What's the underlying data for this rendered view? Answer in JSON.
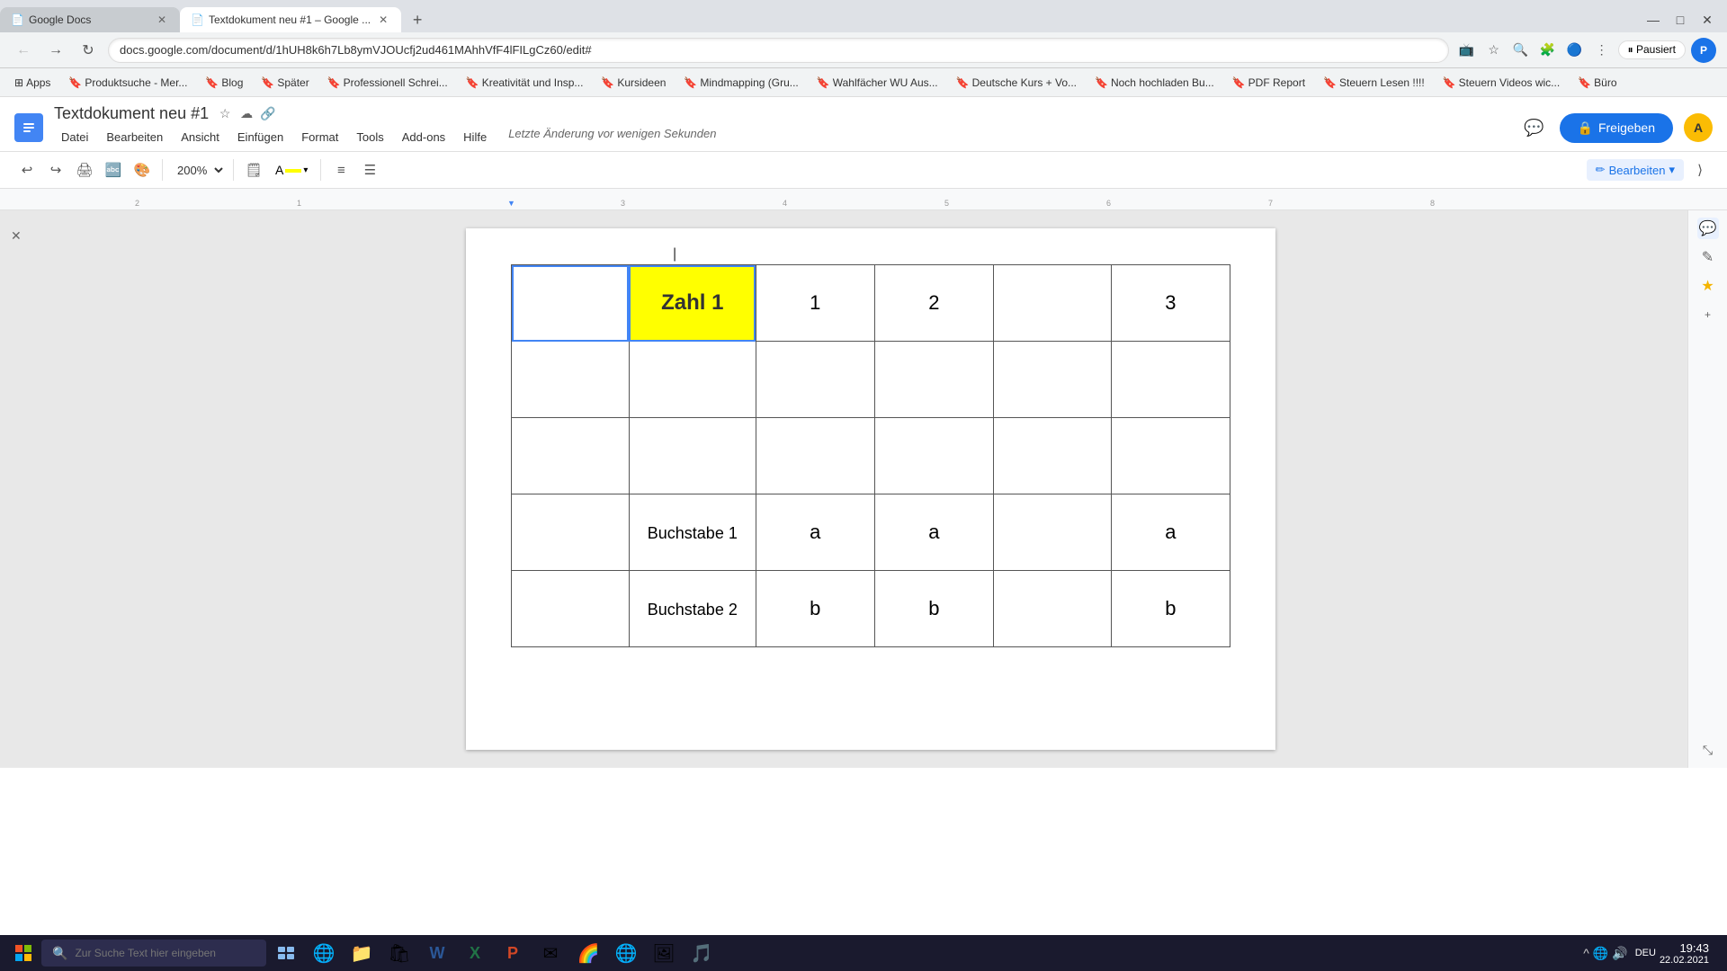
{
  "browser": {
    "tabs": [
      {
        "id": "tab1",
        "title": "Google Docs",
        "favicon": "📄",
        "active": false
      },
      {
        "id": "tab2",
        "title": "Textdokument neu #1 – Google ...",
        "favicon": "📄",
        "active": true
      }
    ],
    "address": "docs.google.com/document/d/1hUH8k6h7Lb8ymVJOUcfj2ud461MAhhVfF4lFILgCz60/edit#",
    "window_controls": [
      "—",
      "□",
      "✕"
    ]
  },
  "bookmarks": [
    {
      "label": "Apps",
      "icon": "⊞"
    },
    {
      "label": "Produktsuche - Mer...",
      "icon": "🔖"
    },
    {
      "label": "Blog",
      "icon": "🔖"
    },
    {
      "label": "Später",
      "icon": "🔖"
    },
    {
      "label": "Professionell Schrei...",
      "icon": "🔖"
    },
    {
      "label": "Kreativität und Insp...",
      "icon": "🔖"
    },
    {
      "label": "Kursideen",
      "icon": "🔖"
    },
    {
      "label": "Mindmapping (Gru...",
      "icon": "🔖"
    },
    {
      "label": "Wahlfächer WU Aus...",
      "icon": "🔖"
    },
    {
      "label": "Deutsche Kurs + Vo...",
      "icon": "🔖"
    },
    {
      "label": "Noch hochladen Bu...",
      "icon": "🔖"
    },
    {
      "label": "PDF Report",
      "icon": "🔖"
    },
    {
      "label": "Steuern Lesen !!!!",
      "icon": "🔖"
    },
    {
      "label": "Steuern Videos wic...",
      "icon": "🔖"
    },
    {
      "label": "Büro",
      "icon": "🔖"
    }
  ],
  "docs": {
    "title": "Textdokument neu #1",
    "autosave": "Letzte Änderung vor wenigen Sekunden",
    "menu": [
      "Datei",
      "Bearbeiten",
      "Ansicht",
      "Einfügen",
      "Format",
      "Tools",
      "Add-ons",
      "Hilfe"
    ],
    "toolbar": {
      "zoom": "200%",
      "edit_mode": "Bearbeiten",
      "share_label": "Freigeben"
    },
    "table": {
      "rows": [
        [
          "",
          "Zahl 1",
          "1",
          "2",
          "",
          "3"
        ],
        [
          "",
          "",
          "",
          "",
          "",
          ""
        ],
        [
          "",
          "",
          "",
          "",
          "",
          ""
        ],
        [
          "",
          "Buchstabe 1",
          "a",
          "a",
          "",
          "a"
        ],
        [
          "",
          "Buchstabe 2",
          "b",
          "b",
          "",
          "b"
        ]
      ],
      "highlighted_cell": {
        "row": 0,
        "col": 1
      }
    }
  },
  "taskbar": {
    "search_placeholder": "Zur Suche Text hier eingeben",
    "time": "19:43",
    "date": "22.02.2021",
    "language": "DEU"
  }
}
